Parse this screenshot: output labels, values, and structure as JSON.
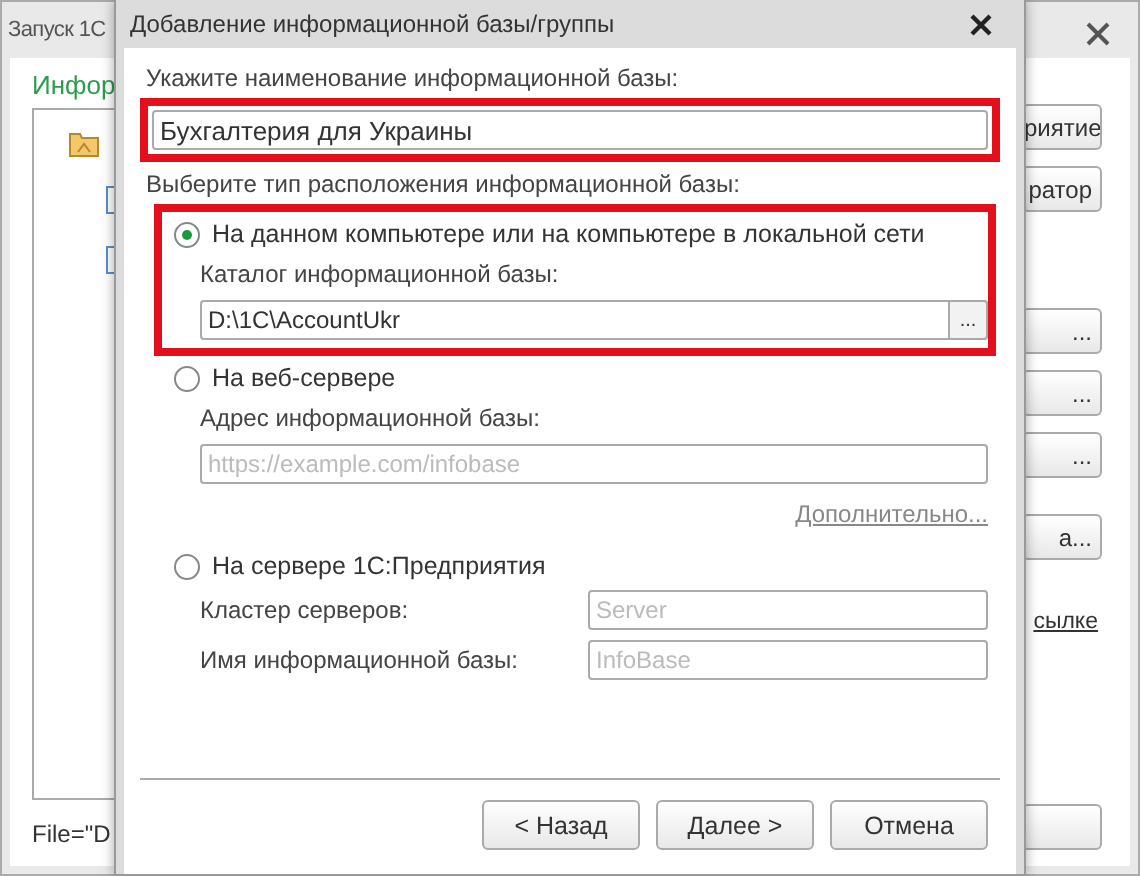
{
  "background_window": {
    "title": "Запуск 1С",
    "heading": "Инфор",
    "side_buttons": [
      {
        "label": "риятие"
      },
      {
        "label": "ратор"
      },
      {
        "label": "..."
      },
      {
        "label": "..."
      },
      {
        "label": "..."
      },
      {
        "label": "а..."
      }
    ],
    "link": "сылке",
    "status_text": "File=\"D"
  },
  "dialog": {
    "title": "Добавление информационной базы/группы",
    "name_label": "Укажите наименование информационной базы:",
    "name_value": "Бухгалтерия для Украины",
    "name_highlighted": true,
    "location_label": "Выберите тип расположения информационной базы:",
    "options": [
      {
        "label": "На данном компьютере или на компьютере в локальной сети",
        "selected": true,
        "highlighted": true,
        "fields": [
          {
            "kind": "stacked",
            "label": "Каталог информационной базы:",
            "value": "D:\\1C\\AccountUkr",
            "browse": "..."
          }
        ]
      },
      {
        "label": "На веб-сервере",
        "selected": false,
        "highlighted": false,
        "fields": [
          {
            "kind": "stacked",
            "label": "Адрес информационной базы:",
            "placeholder": "https://example.com/infobase"
          }
        ],
        "link": "Дополнительно..."
      },
      {
        "label": "На сервере 1С:Предприятия",
        "selected": false,
        "highlighted": false,
        "fields": [
          {
            "kind": "inline",
            "label": "Кластер серверов:",
            "placeholder": "Server"
          },
          {
            "kind": "inline",
            "label": "Имя информационной базы:",
            "placeholder": "InfoBase"
          }
        ]
      }
    ],
    "buttons": [
      {
        "label": "< Назад"
      },
      {
        "label": "Далее >"
      },
      {
        "label": "Отмена"
      }
    ]
  }
}
